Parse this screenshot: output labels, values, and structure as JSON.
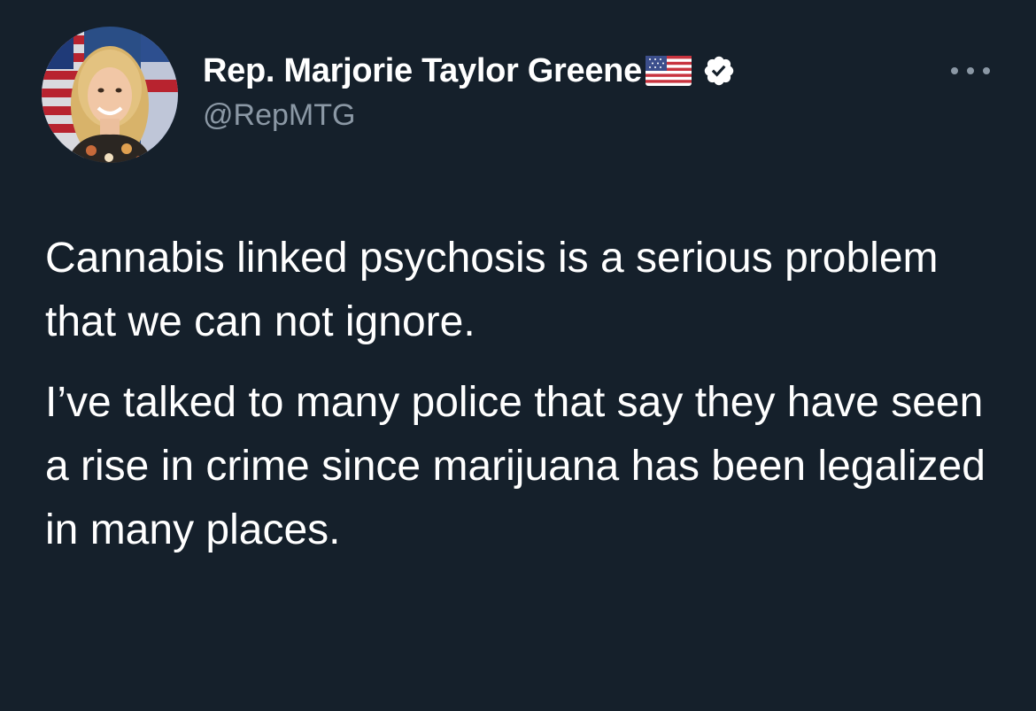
{
  "tweet": {
    "author": {
      "display_name": "Rep. Marjorie Taylor Greene",
      "handle": "@RepMTG",
      "name_emoji_icon": "us-flag-icon",
      "verified_icon": "verified-badge-icon",
      "avatar_icon": "profile-photo"
    },
    "more_icon": "more-options-icon",
    "paragraphs": [
      "Cannabis linked psychosis is a serious problem that we can not ignore.",
      "I’ve talked to many police that say they have seen a rise in crime since marijuana has been legalized in many places."
    ]
  },
  "colors": {
    "background": "#15202b",
    "text_primary": "#ffffff",
    "text_secondary": "#8b98a5"
  }
}
